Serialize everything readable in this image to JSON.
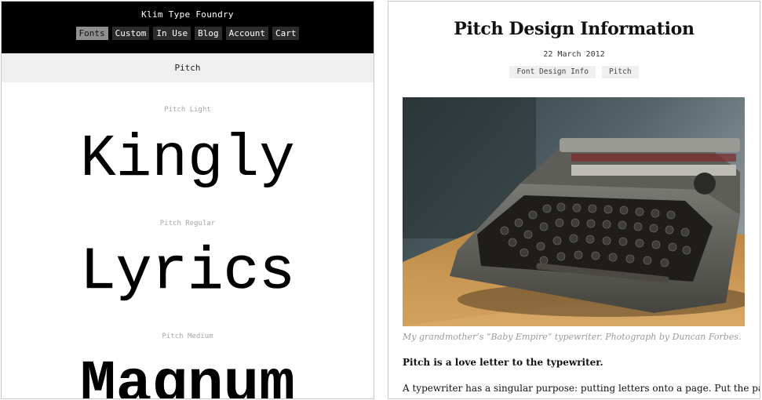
{
  "left_page": {
    "site_title": "Klim Type Foundry",
    "nav": [
      {
        "label": "Fonts",
        "active": true
      },
      {
        "label": "Custom",
        "active": false
      },
      {
        "label": "In Use",
        "active": false
      },
      {
        "label": "Blog",
        "active": false
      },
      {
        "label": "Account",
        "active": false
      },
      {
        "label": "Cart",
        "active": false
      }
    ],
    "section_title": "Pitch",
    "specimens": [
      {
        "weight": "Pitch Light",
        "word": "Kingly"
      },
      {
        "weight": "Pitch Regular",
        "word": "Lyrics"
      },
      {
        "weight": "Pitch Medium",
        "word": "Magnum"
      }
    ]
  },
  "right_page": {
    "title": "Pitch Design Information",
    "date": "22 March 2012",
    "tags": [
      "Font Design Info",
      "Pitch"
    ],
    "caption": "My grandmother’s “Baby Empire” typewriter. Photograph by Duncan Forbes.",
    "lead": "Pitch is a love letter to the typewriter.",
    "body": "A typewriter has a singular purpose: putting letters onto a page. Put the paper in,"
  },
  "colors": {
    "nav_background": "#000000",
    "nav_item": "#2c2c2c",
    "nav_active": "#8f8f8f",
    "subbar": "#efefef",
    "tag_background": "#efefef"
  }
}
